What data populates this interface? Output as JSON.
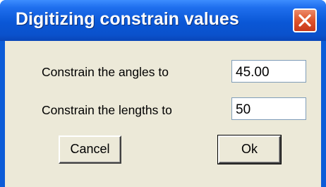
{
  "window": {
    "title": "Digitizing constrain values",
    "close_icon": "close-icon"
  },
  "form": {
    "angles_label": "Constrain the angles to",
    "angles_value": "45.00",
    "lengths_label": "Constrain the lengths to",
    "lengths_value": "50"
  },
  "buttons": {
    "cancel_label": "Cancel",
    "ok_label": "Ok"
  },
  "colors": {
    "titlebar": "#0a57d6",
    "client_background": "#ece9d8",
    "close_button": "#e0582f"
  }
}
